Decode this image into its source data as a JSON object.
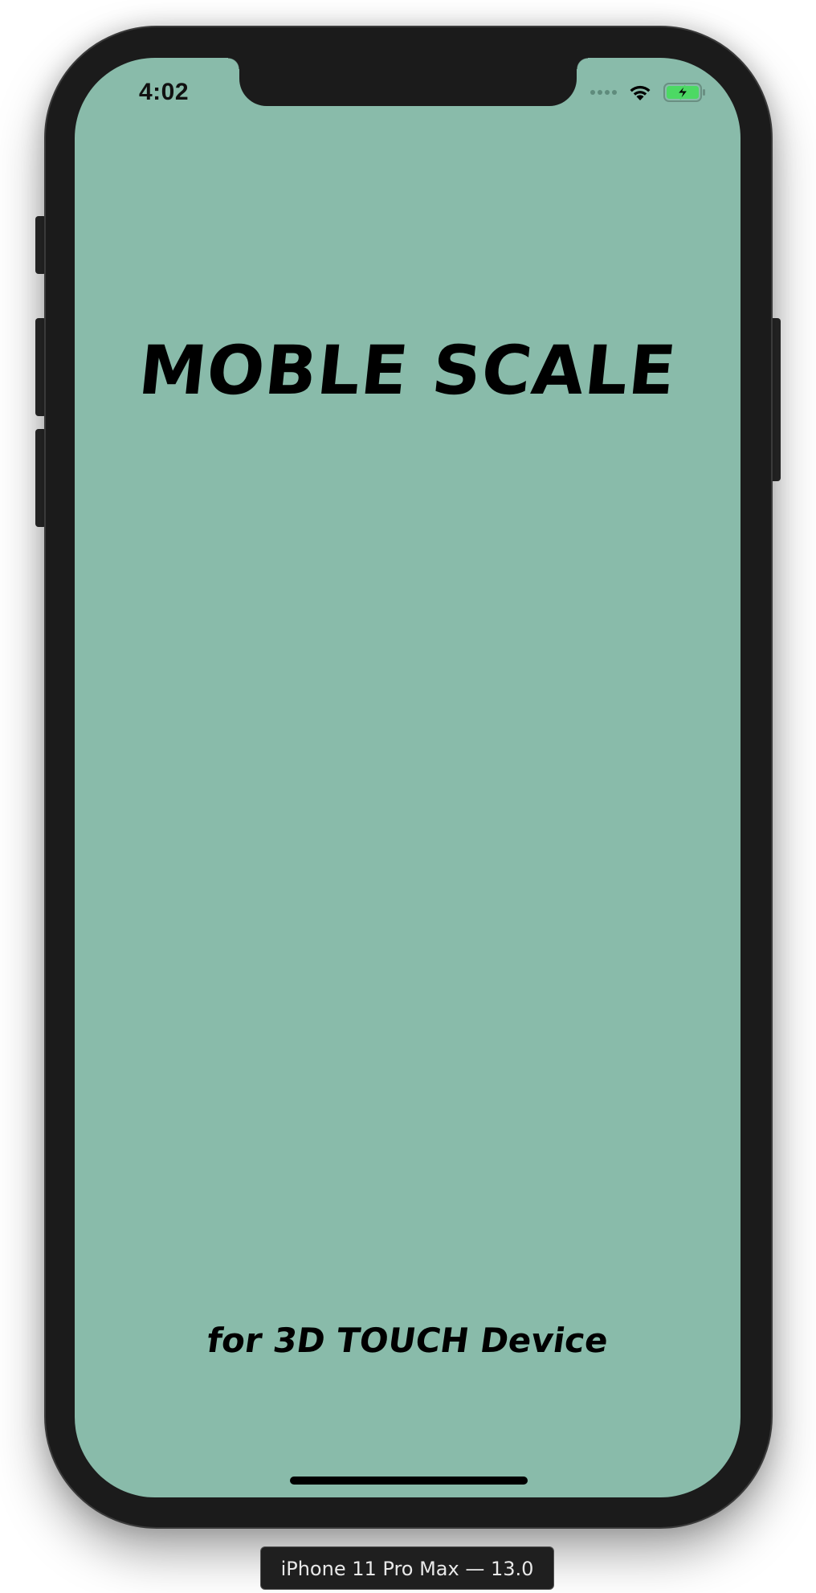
{
  "status_bar": {
    "time": "4:02",
    "icons": [
      "signal-dots-icon",
      "wifi-icon",
      "battery-charging-icon"
    ]
  },
  "app": {
    "title": "MOBLE SCALE",
    "subtitle": "for 3D TOUCH Device",
    "background_color": "#89bbaa"
  },
  "simulator": {
    "device_label": "iPhone 11 Pro Max — 13.0"
  },
  "colors": {
    "bezel": "#1b1b1b",
    "battery_fill": "#4cd964"
  }
}
